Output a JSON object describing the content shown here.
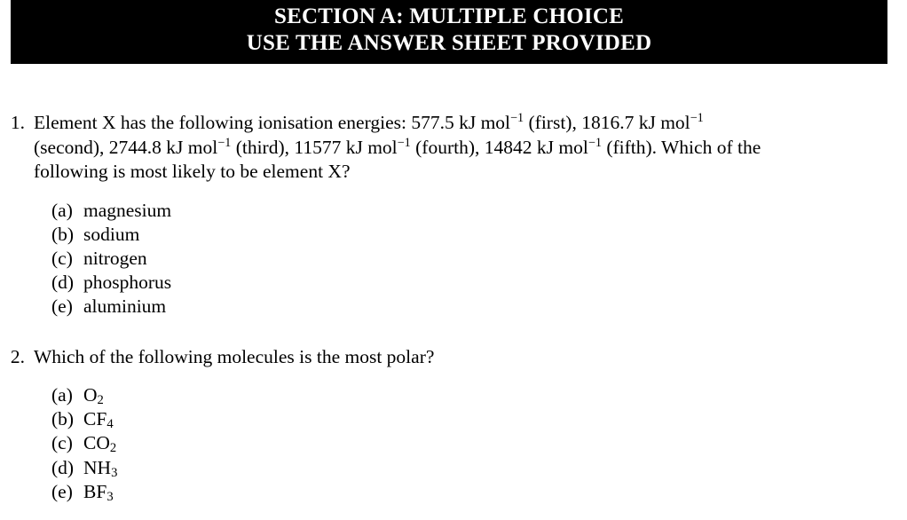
{
  "document": {
    "header": {
      "line1": "SECTION A: MULTIPLE CHOICE",
      "line2": "USE THE ANSWER SHEET PROVIDED",
      "background_color": "#000000",
      "text_color": "#ffffff"
    },
    "page_background": "#ffffff",
    "body_text_color": "#000000",
    "questions": [
      {
        "number": "1.",
        "lines": [
          {
            "segments": [
              {
                "text": "Element X has the following ionisation energies: 577.5 kJ mol"
              },
              {
                "text": "−1",
                "style": "sup"
              },
              {
                "text": " (first), 1816.7 kJ mol"
              },
              {
                "text": "−1",
                "style": "sup"
              }
            ]
          },
          {
            "segments": [
              {
                "text": "(second), 2744.8 kJ mol"
              },
              {
                "text": "−1",
                "style": "sup"
              },
              {
                "text": " (third), 11577 kJ mol"
              },
              {
                "text": "−1",
                "style": "sup"
              },
              {
                "text": " (fourth), 14842 kJ mol"
              },
              {
                "text": "−1",
                "style": "sup"
              },
              {
                "text": " (fifth). Which of the"
              }
            ]
          },
          {
            "segments": [
              {
                "text": "following is most likely to be element X?"
              }
            ]
          }
        ],
        "options": [
          {
            "letter": "(a)",
            "segments": [
              {
                "text": "magnesium"
              }
            ]
          },
          {
            "letter": "(b)",
            "segments": [
              {
                "text": "sodium"
              }
            ]
          },
          {
            "letter": "(c)",
            "segments": [
              {
                "text": "nitrogen"
              }
            ]
          },
          {
            "letter": "(d)",
            "segments": [
              {
                "text": "phosphorus"
              }
            ]
          },
          {
            "letter": "(e)",
            "segments": [
              {
                "text": "aluminium"
              }
            ]
          }
        ]
      },
      {
        "number": "2.",
        "lines": [
          {
            "segments": [
              {
                "text": "Which of the following molecules is the most polar?"
              }
            ]
          }
        ],
        "options": [
          {
            "letter": "(a)",
            "segments": [
              {
                "text": "O"
              },
              {
                "text": "2",
                "style": "sub"
              }
            ]
          },
          {
            "letter": "(b)",
            "segments": [
              {
                "text": "CF"
              },
              {
                "text": "4",
                "style": "sub"
              }
            ]
          },
          {
            "letter": "(c)",
            "segments": [
              {
                "text": "CO"
              },
              {
                "text": "2",
                "style": "sub"
              }
            ]
          },
          {
            "letter": "(d)",
            "segments": [
              {
                "text": "NH"
              },
              {
                "text": "3",
                "style": "sub"
              }
            ]
          },
          {
            "letter": "(e)",
            "segments": [
              {
                "text": "BF"
              },
              {
                "text": "3",
                "style": "sub"
              }
            ]
          }
        ]
      }
    ]
  }
}
